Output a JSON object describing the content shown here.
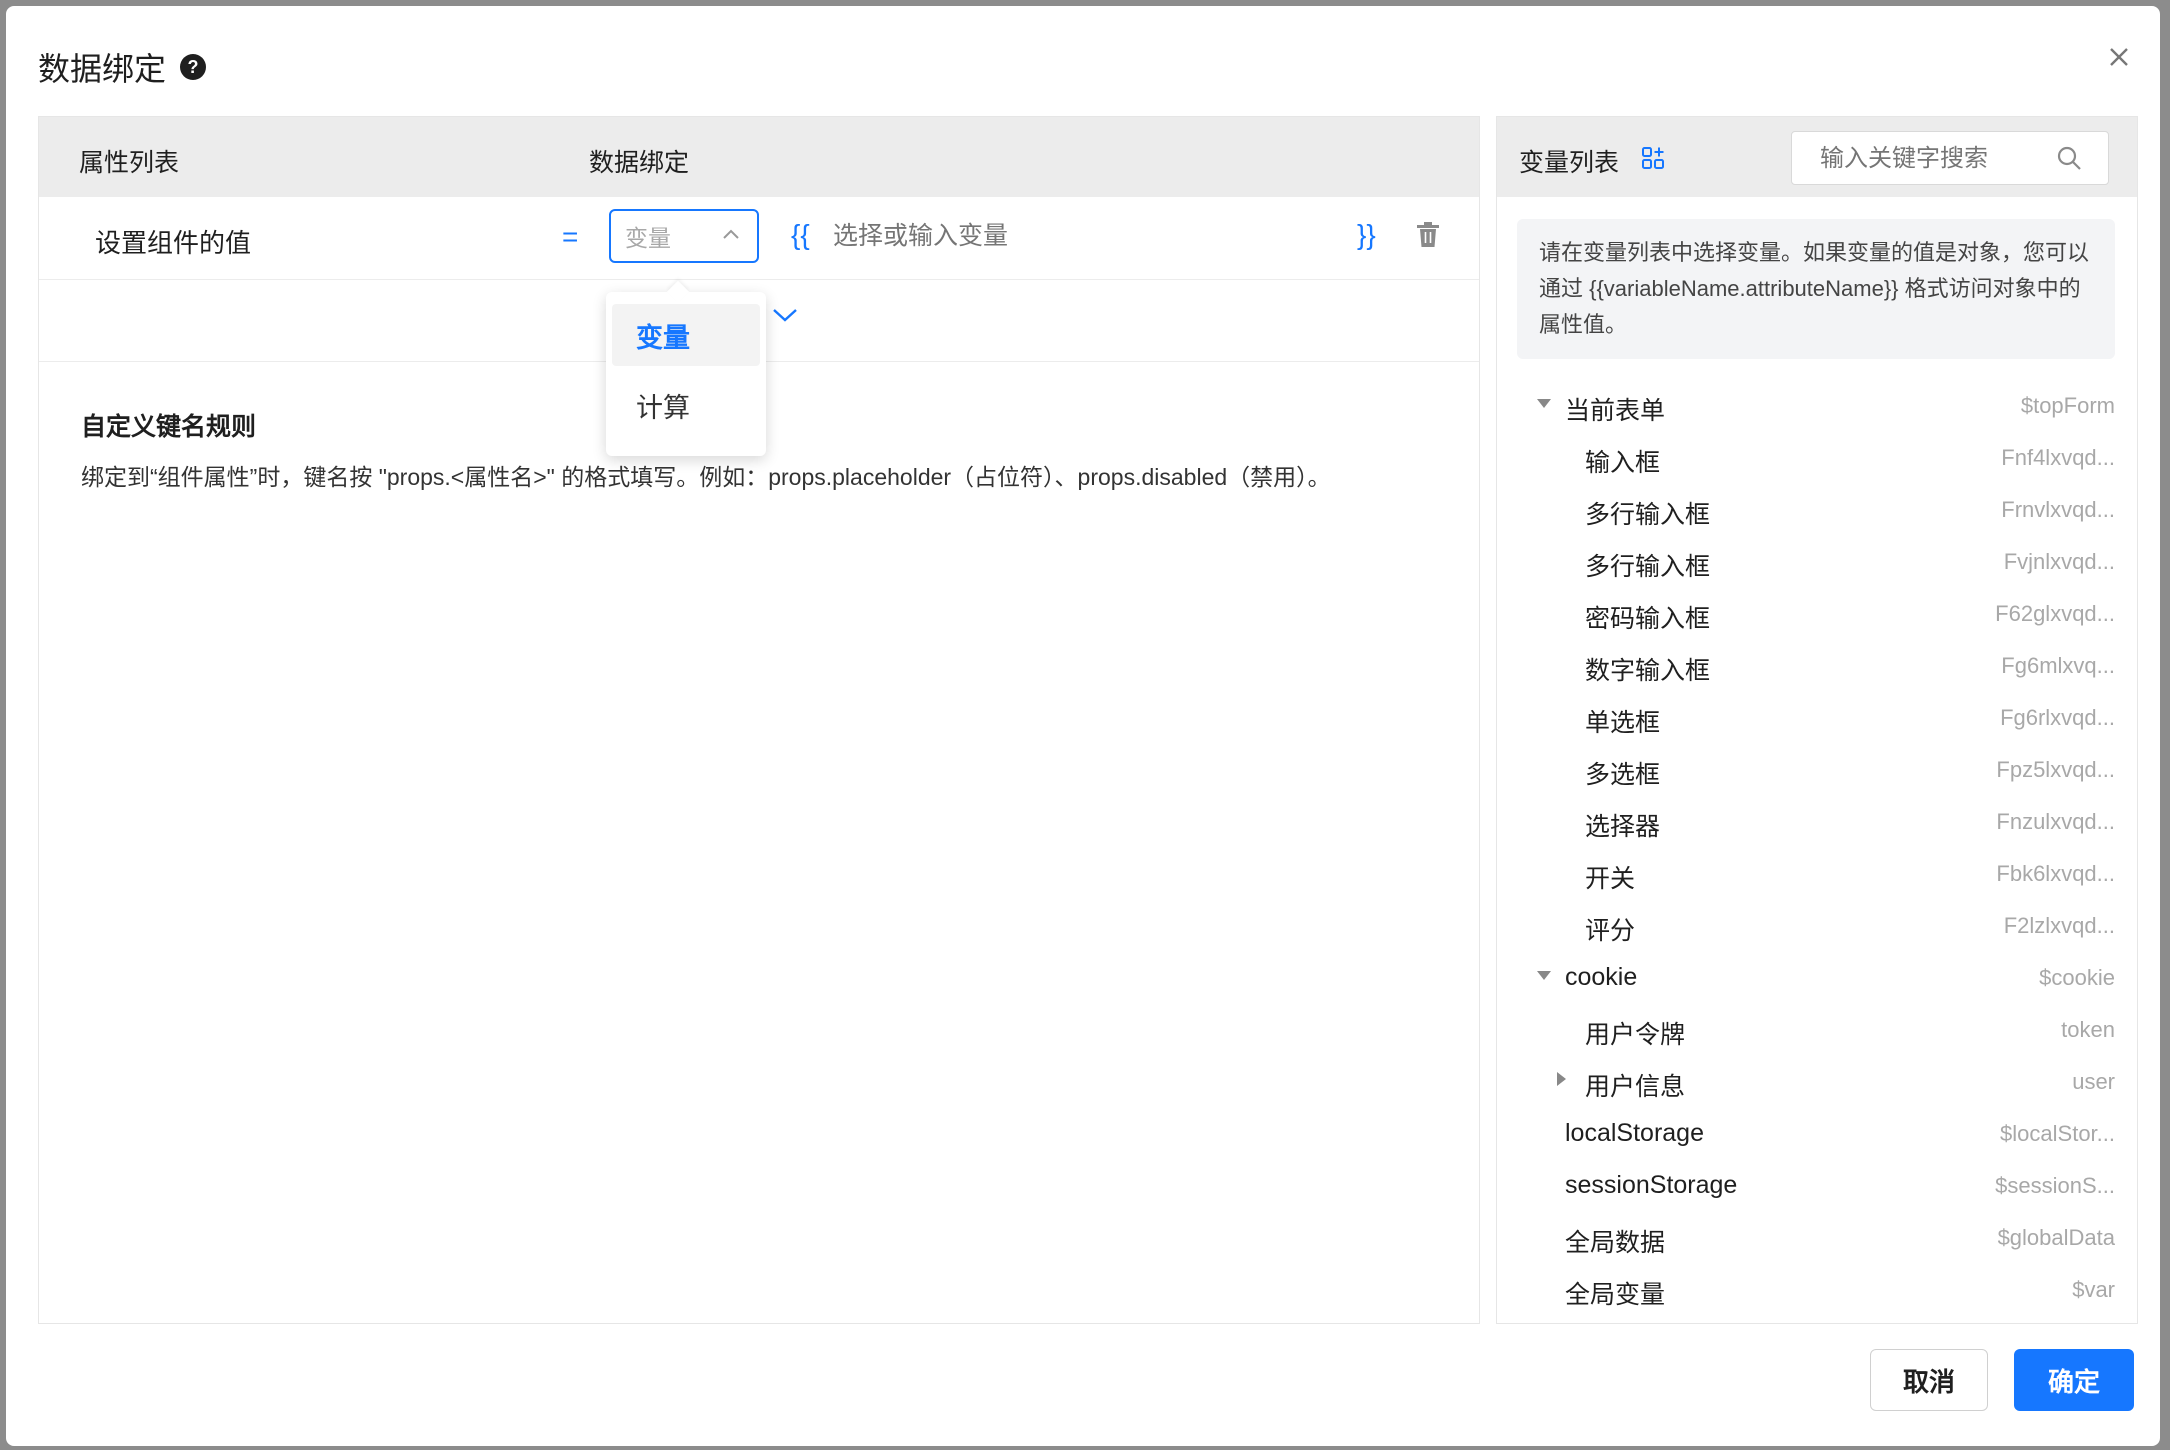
{
  "modal": {
    "title": "数据绑定",
    "help_icon_text": "?"
  },
  "left": {
    "header_col1": "属性列表",
    "header_col2": "数据绑定",
    "row": {
      "prop_name": "设置组件的值",
      "equals": "=",
      "select_value": "变量",
      "brace_open": "{{",
      "input_placeholder": "选择或输入变量",
      "brace_close": "}}"
    },
    "rules_title": "自定义键名规则",
    "rules_text": "绑定到“组件属性”时，键名按 \"props.<属性名>\" 的格式填写。例如：props.placeholder（占位符）、props.disabled（禁用）。"
  },
  "dropdown": {
    "options": [
      "变量",
      "计算"
    ],
    "selected": "变量"
  },
  "right": {
    "title": "变量列表",
    "search_placeholder": "输入关键字搜索",
    "hint": "请在变量列表中选择变量。如果变量的值是对象，您可以通过 {{variableName.attributeName}} 格式访问对象中的属性值。",
    "tree": [
      {
        "label": "当前表单",
        "value": "$topForm",
        "level": 0,
        "caret": "down"
      },
      {
        "label": "输入框",
        "value": "Fnf4lxvqd...",
        "level": 1,
        "caret": "none"
      },
      {
        "label": "多行输入框",
        "value": "Frnvlxvqd...",
        "level": 1,
        "caret": "none"
      },
      {
        "label": "多行输入框",
        "value": "Fvjnlxvqd...",
        "level": 1,
        "caret": "none"
      },
      {
        "label": "密码输入框",
        "value": "F62glxvqd...",
        "level": 1,
        "caret": "none"
      },
      {
        "label": "数字输入框",
        "value": "Fg6mlxvq...",
        "level": 1,
        "caret": "none"
      },
      {
        "label": "单选框",
        "value": "Fg6rlxvqd...",
        "level": 1,
        "caret": "none"
      },
      {
        "label": "多选框",
        "value": "Fpz5lxvqd...",
        "level": 1,
        "caret": "none"
      },
      {
        "label": "选择器",
        "value": "Fnzulxvqd...",
        "level": 1,
        "caret": "none"
      },
      {
        "label": "开关",
        "value": "Fbk6lxvqd...",
        "level": 1,
        "caret": "none"
      },
      {
        "label": "评分",
        "value": "F2lzlxvqd...",
        "level": 1,
        "caret": "none"
      },
      {
        "label": "cookie",
        "value": "$cookie",
        "level": 0,
        "caret": "down"
      },
      {
        "label": "用户令牌",
        "value": "token",
        "level": 1,
        "caret": "none"
      },
      {
        "label": "用户信息",
        "value": "user",
        "level": 1,
        "caret": "right"
      },
      {
        "label": "localStorage",
        "value": "$localStor...",
        "level": 0,
        "caret": "none"
      },
      {
        "label": "sessionStorage",
        "value": "$sessionS...",
        "level": 0,
        "caret": "none"
      },
      {
        "label": "全局数据",
        "value": "$globalData",
        "level": 0,
        "caret": "none"
      },
      {
        "label": "全局变量",
        "value": "$var",
        "level": 0,
        "caret": "none"
      }
    ]
  },
  "footer": {
    "cancel_label": "取消",
    "ok_label": "确定"
  },
  "colors": {
    "accent": "#1677ff",
    "header_bg": "#ececec",
    "muted_text": "#a8a8a8"
  }
}
